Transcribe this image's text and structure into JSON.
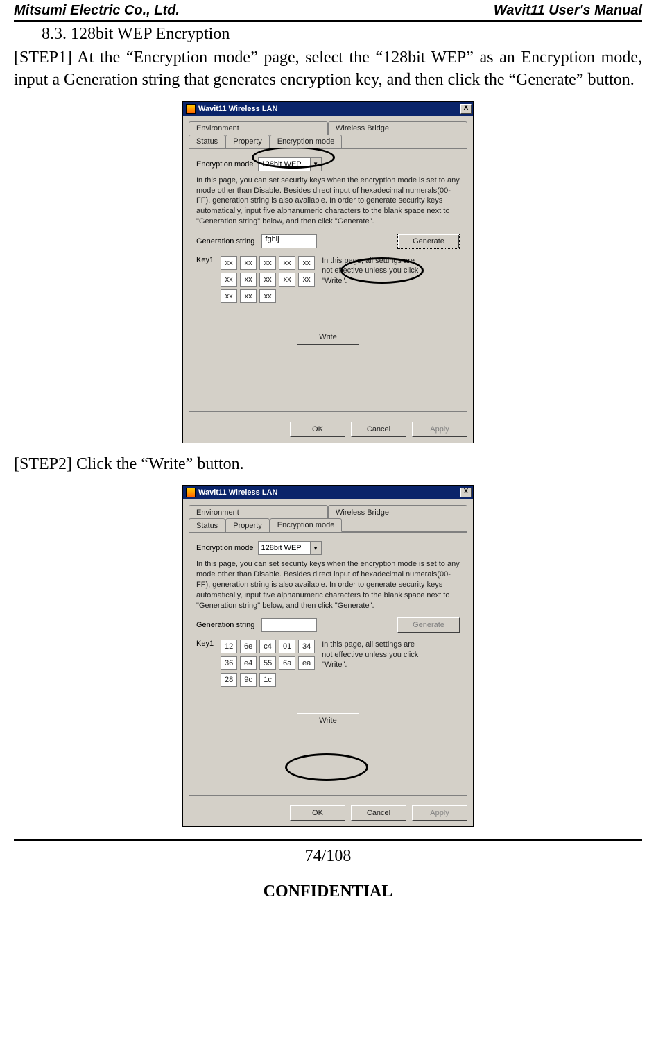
{
  "header": {
    "left": "Mitsumi Electric Co., Ltd.",
    "right": "Wavit11 User's Manual"
  },
  "section": {
    "number": "8.3.",
    "title": "128bit WEP Encryption"
  },
  "step1": "[STEP1] At the “Encryption mode” page, select the “128bit WEP” as an Encryption mode, input a Generation string that generates encryption key, and then click the “Generate” button.",
  "step2": "[STEP2] Click the “Write” button.",
  "dialog": {
    "title": "Wavit11 Wireless LAN",
    "close": "X",
    "tabs": {
      "environment": "Environment",
      "wireless_bridge": "Wireless Bridge",
      "status": "Status",
      "property": "Property",
      "encryption_mode": "Encryption mode"
    },
    "enc_mode_label": "Encryption mode",
    "enc_mode_value": "128bit WEP",
    "help": "In this page, you can set security keys when the encryption mode is set to any mode other than Disable. Besides direct input of hexadecimal numerals(00-FF), generation string is also available. In order to generate security keys automatically, input five alphanumeric characters to the blank space next to \"Generation string\" below, and then click \"Generate\".",
    "gen_label": "Generation string",
    "gen_value_1": "fghij",
    "gen_value_2": "",
    "generate_btn": "Generate",
    "key_label": "Key1",
    "side_note": "In this page, all settings are not effective unless you click \"Write\".",
    "write_btn": "Write",
    "ok_btn": "OK",
    "cancel_btn": "Cancel",
    "apply_btn": "Apply",
    "hex1": [
      [
        "xx",
        "xx",
        "xx",
        "xx",
        "xx"
      ],
      [
        "xx",
        "xx",
        "xx",
        "xx",
        "xx"
      ],
      [
        "xx",
        "xx",
        "xx"
      ]
    ],
    "hex2": [
      [
        "12",
        "6e",
        "c4",
        "01",
        "34"
      ],
      [
        "36",
        "e4",
        "55",
        "6a",
        "ea"
      ],
      [
        "28",
        "9c",
        "1c"
      ]
    ]
  },
  "footer": {
    "page": "74/108",
    "confidential": "CONFIDENTIAL"
  }
}
